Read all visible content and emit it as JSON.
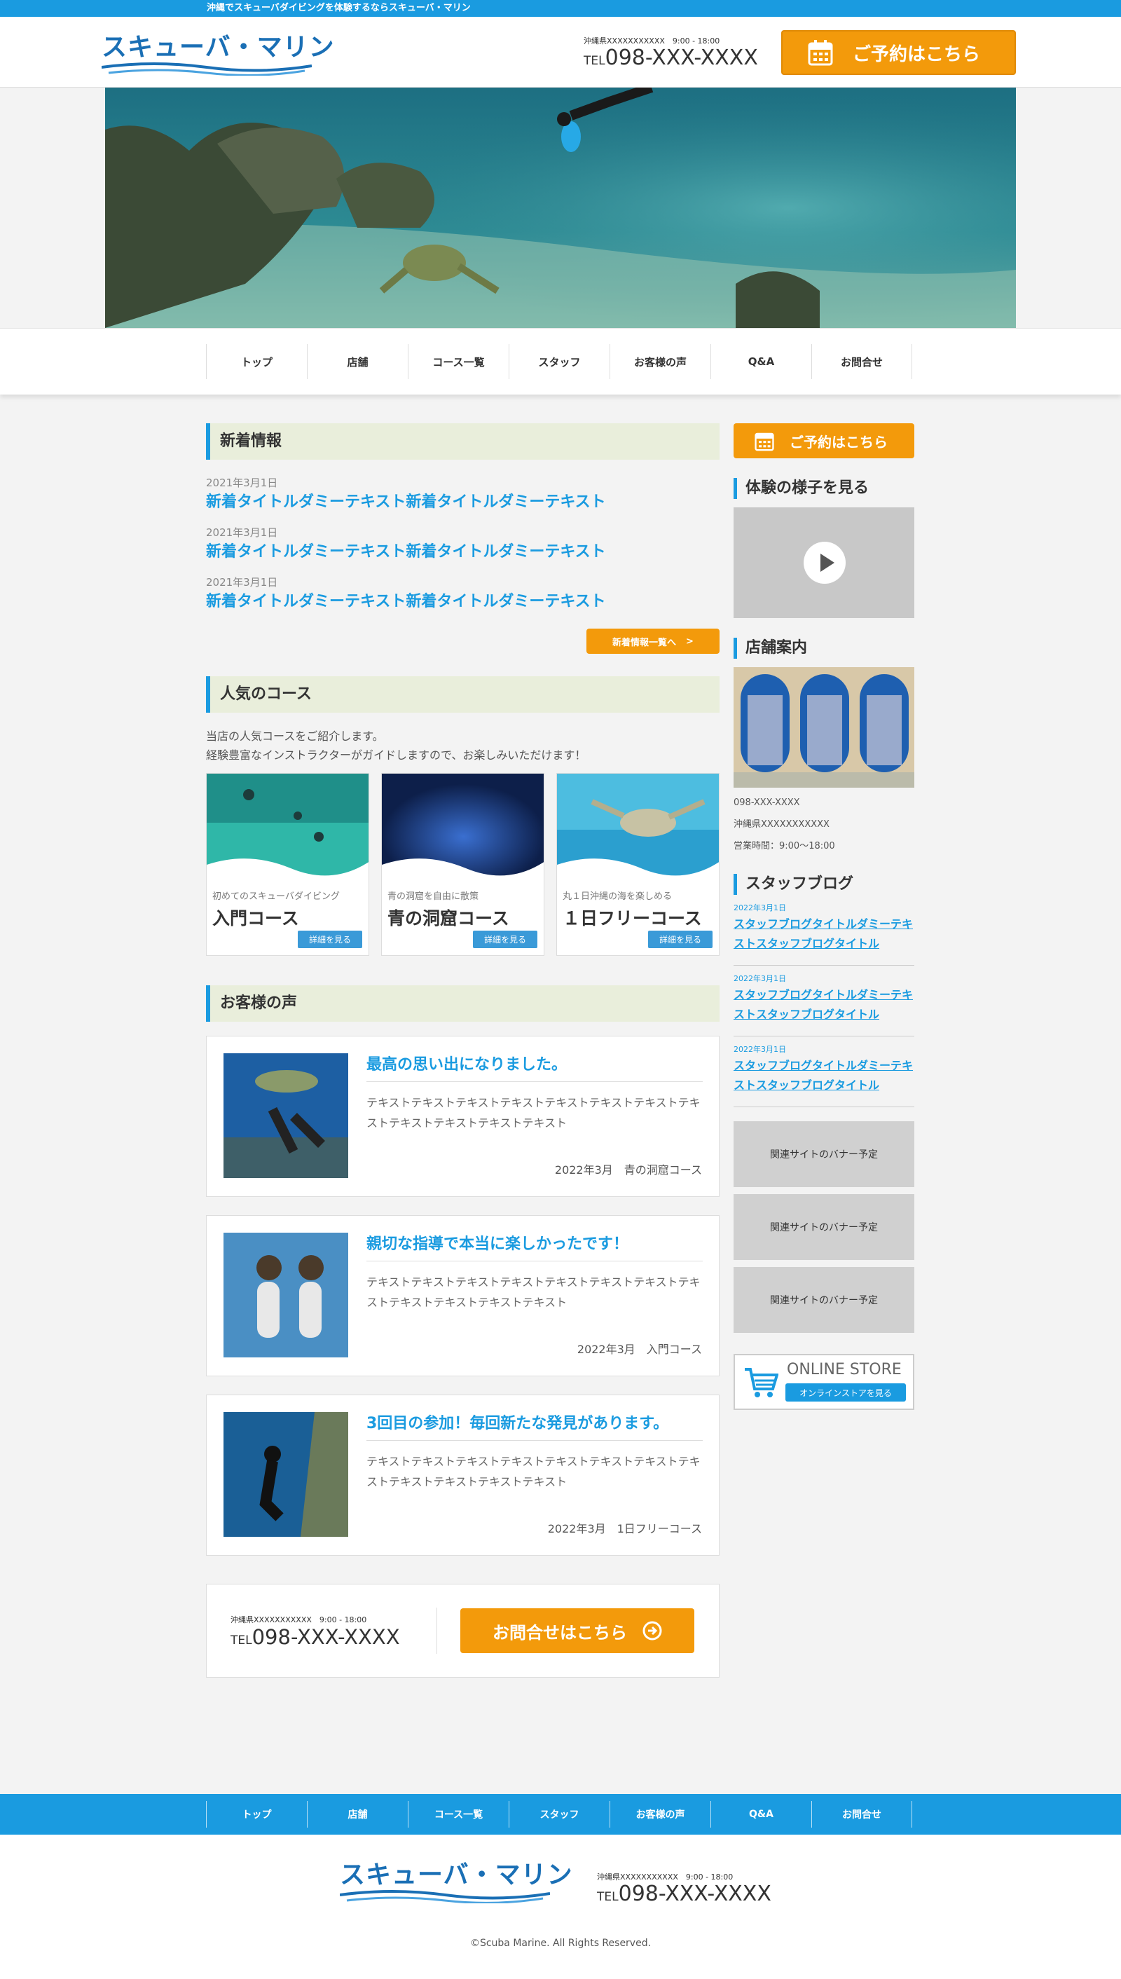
{
  "topbar": {
    "text": "沖縄でスキューバダイビングを体験するならスキューバ・マリン"
  },
  "header": {
    "logo": "スキューバ・マリン",
    "address_hours": "沖縄県XXXXXXXXXXX　9:00 - 18:00",
    "tel_prefix": "TEL",
    "tel": "098-XXX-XXXX",
    "reserve_label": "ご予約はこちら"
  },
  "nav": [
    "トップ",
    "店舗",
    "コース一覧",
    "スタッフ",
    "お客様の声",
    "Q&A",
    "お問合せ"
  ],
  "news": {
    "title": "新着情報",
    "items": [
      {
        "date": "2021年3月1日",
        "title": "新着タイトルダミーテキスト新着タイトルダミーテキスト"
      },
      {
        "date": "2021年3月1日",
        "title": "新着タイトルダミーテキスト新着タイトルダミーテキスト"
      },
      {
        "date": "2021年3月1日",
        "title": "新着タイトルダミーテキスト新着タイトルダミーテキスト"
      }
    ],
    "more_label": "新着情報一覧へ"
  },
  "courses": {
    "title": "人気のコース",
    "desc1": "当店の人気コースをご紹介します。",
    "desc2": "経験豊富なインストラクターがガイドしますので、お楽しみいただけます！",
    "items": [
      {
        "sub": "初めてのスキューバダイビング",
        "name": "入門コース",
        "btn": "詳細を見る"
      },
      {
        "sub": "青の洞窟を自由に散策",
        "name": "青の洞窟コース",
        "btn": "詳細を見る"
      },
      {
        "sub": "丸１日沖縄の海を楽しめる",
        "name": "１日フリーコース",
        "btn": "詳細を見る"
      }
    ]
  },
  "voices": {
    "title": "お客様の声",
    "items": [
      {
        "title": "最高の思い出になりました。",
        "text": "テキストテキストテキストテキストテキストテキストテキストテキストテキストテキストテキストテキスト",
        "meta": "2022年3月　青の洞窟コース"
      },
      {
        "title": "親切な指導で本当に楽しかったです！",
        "text": "テキストテキストテキストテキストテキストテキストテキストテキストテキストテキストテキストテキスト",
        "meta": "2022年3月　入門コース"
      },
      {
        "title": "3回目の参加！毎回新たな発見があります。",
        "text": "テキストテキストテキストテキストテキストテキストテキストテキストテキストテキストテキストテキスト",
        "meta": "2022年3月　1日フリーコース"
      }
    ]
  },
  "contact": {
    "label": "お問合せはこちら"
  },
  "sidebar": {
    "reserve_label": "ご予約はこちら",
    "video_title": "体験の様子を見る",
    "shop_title": "店舗案内",
    "shop_tel": "098-XXX-XXXX",
    "shop_address": "沖縄県XXXXXXXXXXX",
    "shop_hours": "営業時間：9:00～18:00",
    "blog_title": "スタッフブログ",
    "blog": [
      {
        "date": "2022年3月1日",
        "title": "スタッフブログタイトルダミーテキストスタッフブログタイトル"
      },
      {
        "date": "2022年3月1日",
        "title": "スタッフブログタイトルダミーテキストスタッフブログタイトル"
      },
      {
        "date": "2022年3月1日",
        "title": "スタッフブログタイトルダミーテキストスタッフブログタイトル"
      }
    ],
    "banners": [
      "関連サイトのバナー予定",
      "関連サイトのバナー予定",
      "関連サイトのバナー予定"
    ],
    "store_title": "ONLINE STORE",
    "store_btn": "オンラインストアを見る"
  },
  "footer": {
    "copyright": "©Scuba Marine. All Rights Reserved."
  },
  "colors": {
    "accent": "#1a9be0",
    "orange": "#f39a0b",
    "section_bg": "#e9eedb"
  },
  "icons": [
    "calendar-icon",
    "play-icon",
    "arrow-right-icon",
    "cart-icon"
  ]
}
